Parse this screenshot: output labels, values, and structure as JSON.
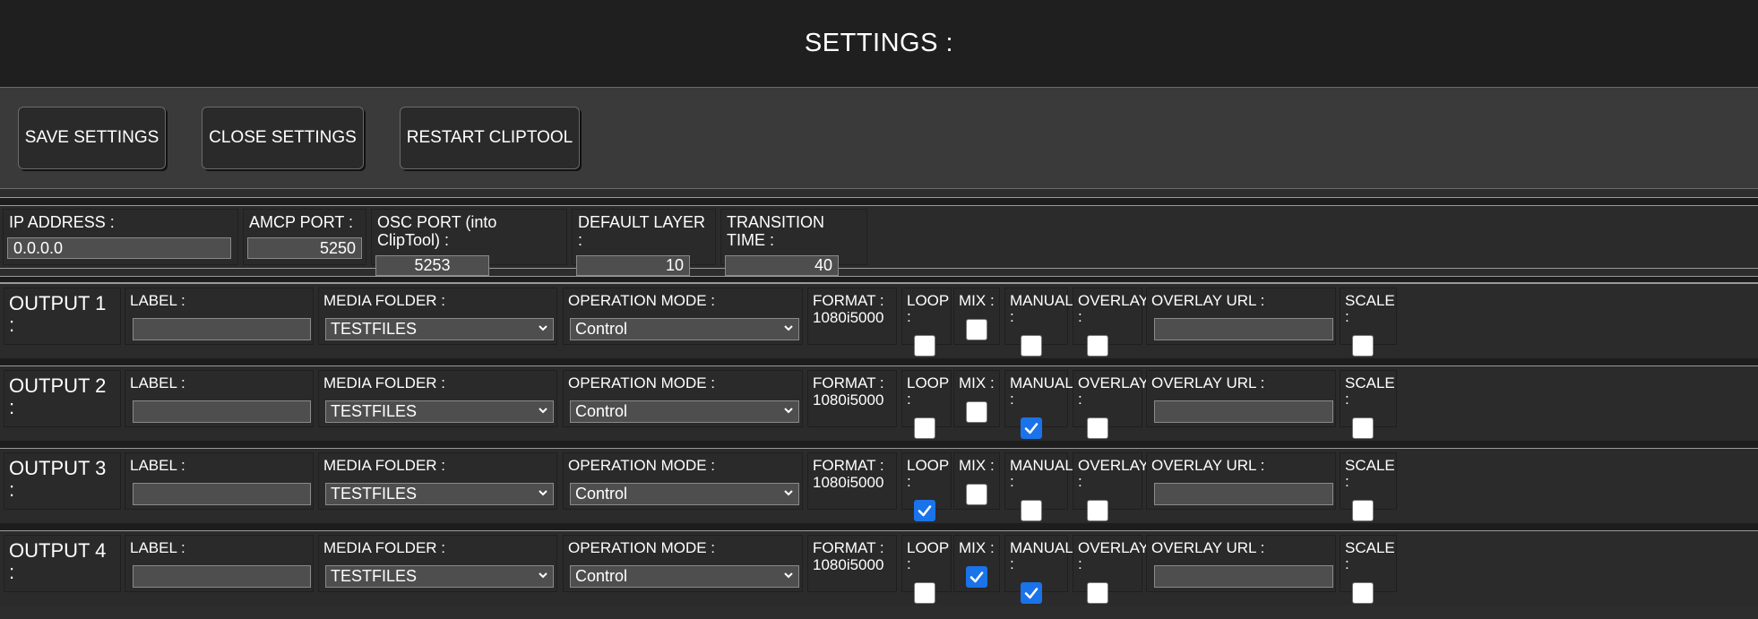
{
  "header": {
    "title": "SETTINGS :"
  },
  "toolbar": {
    "save_label": "SAVE SETTINGS",
    "close_label": "CLOSE SETTINGS",
    "restart_label": "RESTART CLIPTOOL"
  },
  "global": {
    "ip": {
      "label": "IP ADDRESS :",
      "value": "0.0.0.0"
    },
    "amcp": {
      "label": "AMCP PORT :",
      "value": "5250"
    },
    "osc": {
      "label": "OSC PORT (into ClipTool) :",
      "value": "5253"
    },
    "layer": {
      "label": "DEFAULT LAYER :",
      "value": "10"
    },
    "transition": {
      "label": "TRANSITION TIME :",
      "value": "40"
    }
  },
  "labels": {
    "label": "LABEL :",
    "media_folder": "MEDIA FOLDER :",
    "operation_mode": "OPERATION MODE :",
    "format": "FORMAT :",
    "loop": "LOOP :",
    "mix": "MIX :",
    "manual": "MANUAL :",
    "overlay": "OVERLAY :",
    "overlay_url": "OVERLAY URL :",
    "scale": "SCALE :"
  },
  "outputs": [
    {
      "title": "OUTPUT 1 :",
      "label": "",
      "media_folder": "TESTFILES",
      "operation_mode": "Control",
      "format": "1080i5000",
      "loop": false,
      "mix": false,
      "manual": false,
      "overlay": false,
      "overlay_url": "",
      "scale": false
    },
    {
      "title": "OUTPUT 2 :",
      "label": "",
      "media_folder": "TESTFILES",
      "operation_mode": "Control",
      "format": "1080i5000",
      "loop": false,
      "mix": false,
      "manual": true,
      "overlay": false,
      "overlay_url": "",
      "scale": false
    },
    {
      "title": "OUTPUT 3 :",
      "label": "",
      "media_folder": "TESTFILES",
      "operation_mode": "Control",
      "format": "1080i5000",
      "loop": true,
      "mix": false,
      "manual": false,
      "overlay": false,
      "overlay_url": "",
      "scale": false
    },
    {
      "title": "OUTPUT 4 :",
      "label": "",
      "media_folder": "TESTFILES",
      "operation_mode": "Control",
      "format": "1080i5000",
      "loop": false,
      "mix": true,
      "manual": true,
      "overlay": false,
      "overlay_url": "",
      "scale": false
    }
  ],
  "colors": {
    "background": "#2d2d2d",
    "header_bg": "#1f1f1f",
    "toolbar_bg": "#3a3a3a",
    "input_bg": "#4e4e4e",
    "checkbox_checked": "#1a73e8"
  }
}
